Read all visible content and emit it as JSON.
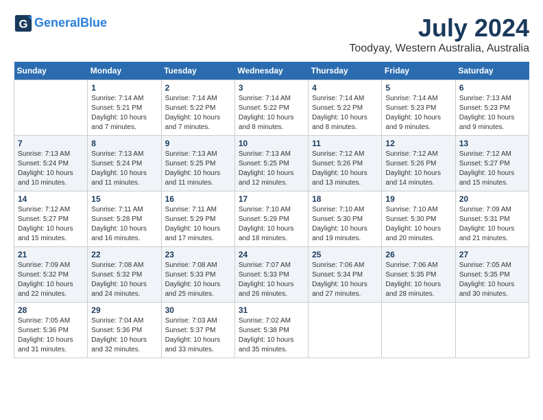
{
  "header": {
    "logo_line1": "General",
    "logo_line2": "Blue",
    "month": "July 2024",
    "location": "Toodyay, Western Australia, Australia"
  },
  "days_of_week": [
    "Sunday",
    "Monday",
    "Tuesday",
    "Wednesday",
    "Thursday",
    "Friday",
    "Saturday"
  ],
  "weeks": [
    [
      {
        "day": "",
        "info": ""
      },
      {
        "day": "1",
        "info": "Sunrise: 7:14 AM\nSunset: 5:21 PM\nDaylight: 10 hours\nand 7 minutes."
      },
      {
        "day": "2",
        "info": "Sunrise: 7:14 AM\nSunset: 5:22 PM\nDaylight: 10 hours\nand 7 minutes."
      },
      {
        "day": "3",
        "info": "Sunrise: 7:14 AM\nSunset: 5:22 PM\nDaylight: 10 hours\nand 8 minutes."
      },
      {
        "day": "4",
        "info": "Sunrise: 7:14 AM\nSunset: 5:22 PM\nDaylight: 10 hours\nand 8 minutes."
      },
      {
        "day": "5",
        "info": "Sunrise: 7:14 AM\nSunset: 5:23 PM\nDaylight: 10 hours\nand 9 minutes."
      },
      {
        "day": "6",
        "info": "Sunrise: 7:13 AM\nSunset: 5:23 PM\nDaylight: 10 hours\nand 9 minutes."
      }
    ],
    [
      {
        "day": "7",
        "info": "Sunrise: 7:13 AM\nSunset: 5:24 PM\nDaylight: 10 hours\nand 10 minutes."
      },
      {
        "day": "8",
        "info": "Sunrise: 7:13 AM\nSunset: 5:24 PM\nDaylight: 10 hours\nand 11 minutes."
      },
      {
        "day": "9",
        "info": "Sunrise: 7:13 AM\nSunset: 5:25 PM\nDaylight: 10 hours\nand 11 minutes."
      },
      {
        "day": "10",
        "info": "Sunrise: 7:13 AM\nSunset: 5:25 PM\nDaylight: 10 hours\nand 12 minutes."
      },
      {
        "day": "11",
        "info": "Sunrise: 7:12 AM\nSunset: 5:26 PM\nDaylight: 10 hours\nand 13 minutes."
      },
      {
        "day": "12",
        "info": "Sunrise: 7:12 AM\nSunset: 5:26 PM\nDaylight: 10 hours\nand 14 minutes."
      },
      {
        "day": "13",
        "info": "Sunrise: 7:12 AM\nSunset: 5:27 PM\nDaylight: 10 hours\nand 15 minutes."
      }
    ],
    [
      {
        "day": "14",
        "info": "Sunrise: 7:12 AM\nSunset: 5:27 PM\nDaylight: 10 hours\nand 15 minutes."
      },
      {
        "day": "15",
        "info": "Sunrise: 7:11 AM\nSunset: 5:28 PM\nDaylight: 10 hours\nand 16 minutes."
      },
      {
        "day": "16",
        "info": "Sunrise: 7:11 AM\nSunset: 5:29 PM\nDaylight: 10 hours\nand 17 minutes."
      },
      {
        "day": "17",
        "info": "Sunrise: 7:10 AM\nSunset: 5:29 PM\nDaylight: 10 hours\nand 18 minutes."
      },
      {
        "day": "18",
        "info": "Sunrise: 7:10 AM\nSunset: 5:30 PM\nDaylight: 10 hours\nand 19 minutes."
      },
      {
        "day": "19",
        "info": "Sunrise: 7:10 AM\nSunset: 5:30 PM\nDaylight: 10 hours\nand 20 minutes."
      },
      {
        "day": "20",
        "info": "Sunrise: 7:09 AM\nSunset: 5:31 PM\nDaylight: 10 hours\nand 21 minutes."
      }
    ],
    [
      {
        "day": "21",
        "info": "Sunrise: 7:09 AM\nSunset: 5:32 PM\nDaylight: 10 hours\nand 22 minutes."
      },
      {
        "day": "22",
        "info": "Sunrise: 7:08 AM\nSunset: 5:32 PM\nDaylight: 10 hours\nand 24 minutes."
      },
      {
        "day": "23",
        "info": "Sunrise: 7:08 AM\nSunset: 5:33 PM\nDaylight: 10 hours\nand 25 minutes."
      },
      {
        "day": "24",
        "info": "Sunrise: 7:07 AM\nSunset: 5:33 PM\nDaylight: 10 hours\nand 26 minutes."
      },
      {
        "day": "25",
        "info": "Sunrise: 7:06 AM\nSunset: 5:34 PM\nDaylight: 10 hours\nand 27 minutes."
      },
      {
        "day": "26",
        "info": "Sunrise: 7:06 AM\nSunset: 5:35 PM\nDaylight: 10 hours\nand 28 minutes."
      },
      {
        "day": "27",
        "info": "Sunrise: 7:05 AM\nSunset: 5:35 PM\nDaylight: 10 hours\nand 30 minutes."
      }
    ],
    [
      {
        "day": "28",
        "info": "Sunrise: 7:05 AM\nSunset: 5:36 PM\nDaylight: 10 hours\nand 31 minutes."
      },
      {
        "day": "29",
        "info": "Sunrise: 7:04 AM\nSunset: 5:36 PM\nDaylight: 10 hours\nand 32 minutes."
      },
      {
        "day": "30",
        "info": "Sunrise: 7:03 AM\nSunset: 5:37 PM\nDaylight: 10 hours\nand 33 minutes."
      },
      {
        "day": "31",
        "info": "Sunrise: 7:02 AM\nSunset: 5:38 PM\nDaylight: 10 hours\nand 35 minutes."
      },
      {
        "day": "",
        "info": ""
      },
      {
        "day": "",
        "info": ""
      },
      {
        "day": "",
        "info": ""
      }
    ]
  ]
}
